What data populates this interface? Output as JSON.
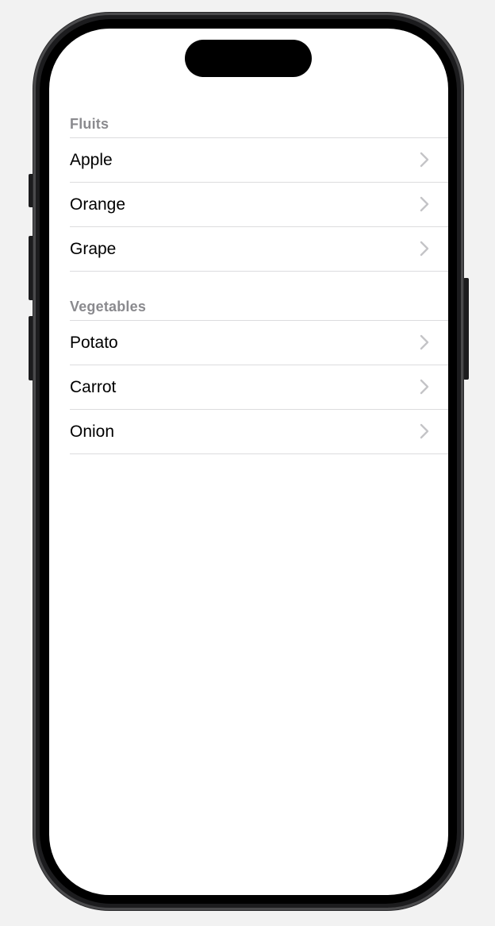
{
  "sections": [
    {
      "header": "Fluits",
      "items": [
        {
          "label": "Apple"
        },
        {
          "label": "Orange"
        },
        {
          "label": "Grape"
        }
      ]
    },
    {
      "header": "Vegetables",
      "items": [
        {
          "label": "Potato"
        },
        {
          "label": "Carrot"
        },
        {
          "label": "Onion"
        }
      ]
    }
  ],
  "icons": {
    "row_accessory": "chevron-right-icon"
  },
  "colors": {
    "background": "#ffffff",
    "section_header": "#8a8a8e",
    "separator": "#dcdcde",
    "chevron": "#c4c4c7",
    "row_text": "#000000"
  }
}
